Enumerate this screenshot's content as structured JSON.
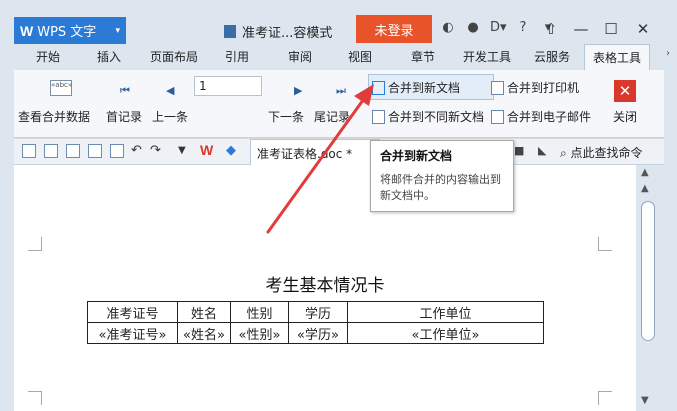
{
  "app": {
    "logo": "W",
    "name": "WPS 文字",
    "dropdown": "▾"
  },
  "window": {
    "doc_title": "准考证...容模式",
    "login": "未登录",
    "help": "?"
  },
  "menu": {
    "tabs": [
      "开始",
      "插入",
      "页面布局",
      "引用",
      "审阅",
      "视图",
      "章节",
      "开发工具",
      "云服务",
      "表格工具"
    ],
    "active": "表格工具"
  },
  "ribbon": {
    "view_merge_data": "查看合并数据",
    "first_record": "首记录",
    "prev_record": "上一条",
    "record_value": "1",
    "next_record": "下一条",
    "last_record": "尾记录",
    "merge_new_doc": "合并到新文档",
    "merge_printer": "合并到打印机",
    "merge_diff_doc": "合并到不同新文档",
    "merge_email": "合并到电子邮件",
    "close": "关闭"
  },
  "quickbar": {
    "doc_tab": "准考证表格.doc *",
    "search_cmd": "点此查找命令"
  },
  "tooltip": {
    "title": "合并到新文档",
    "body": "将邮件合并的内容输出到新文档中。"
  },
  "document": {
    "heading": "考生基本情况卡",
    "table": {
      "headers": [
        "准考证号",
        "姓名",
        "性别",
        "学历",
        "工作单位"
      ],
      "fields": [
        "«准考证号»",
        "«姓名»",
        "«性别»",
        "«学历»",
        "«工作单位»"
      ]
    }
  },
  "colors": {
    "accent": "#2b7bd6",
    "login": "#e8532a",
    "close": "#d9382b",
    "arrow": "#e23b3b"
  }
}
